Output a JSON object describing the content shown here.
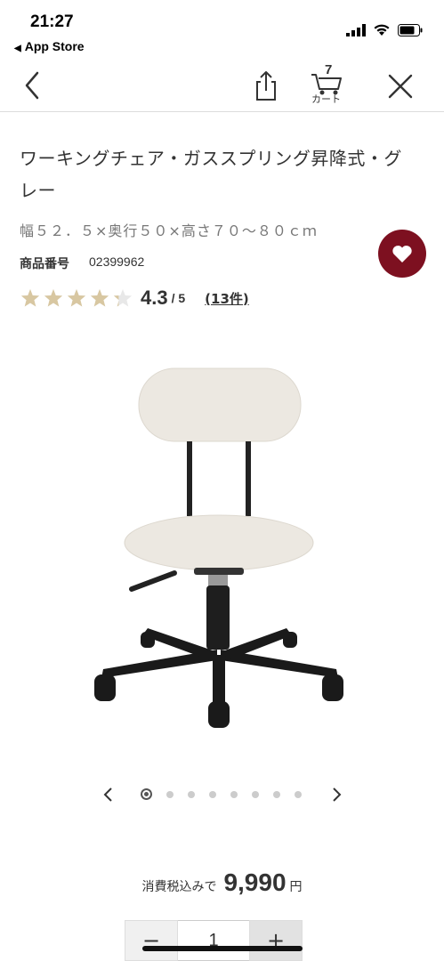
{
  "status_bar": {
    "time": "21:27",
    "back_app": "App Store",
    "back_icon": "triangle-left-icon",
    "icons": [
      "signal-icon",
      "wifi-icon",
      "battery-icon"
    ]
  },
  "nav": {
    "back_icon": "chevron-left-icon",
    "share_icon": "share-icon",
    "cart_icon": "cart-icon",
    "cart_count": "7",
    "cart_label": "カート",
    "close_icon": "close-icon"
  },
  "product": {
    "title": "ワーキングチェア・ガススプリング昇降式・グレー",
    "size": "幅５２．５×奥行５０×高さ７０～８０ｃｍ",
    "code_label": "商品番号",
    "code_value": "02399962",
    "favorite_icon": "heart-icon",
    "rating_value": "4.3",
    "rating_max": "/ 5",
    "rating_stars": 4.3,
    "review_count": "(13件)",
    "image_icon": "office-chair-image"
  },
  "carousel": {
    "prev_icon": "chevron-left-icon",
    "next_icon": "chevron-right-icon",
    "total": 8,
    "active": 1
  },
  "price": {
    "label": "消費税込みで",
    "value": "9,990",
    "unit": "円"
  },
  "quantity": {
    "minus": "−",
    "value": "1",
    "plus": "+"
  },
  "colors": {
    "favorite_bg": "#7d1020",
    "star": "#d8c7a1"
  }
}
